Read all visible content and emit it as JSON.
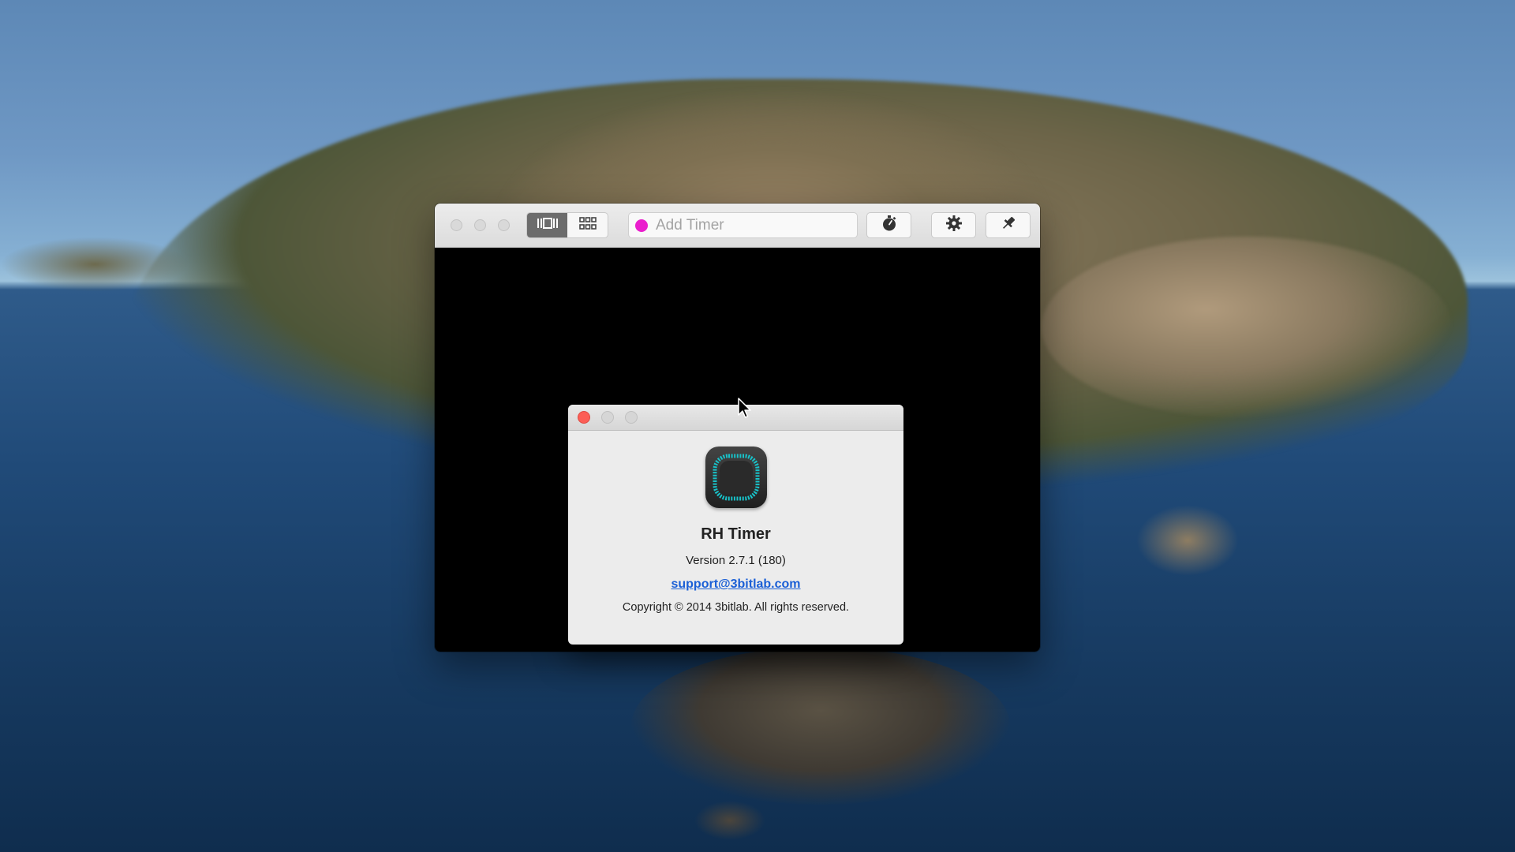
{
  "main_window": {
    "toolbar": {
      "view_modes": [
        "list-view",
        "grid-view"
      ],
      "active_view": "list-view",
      "add_timer_placeholder": "Add Timer",
      "timer_color": "#ea1ecd",
      "buttons": [
        "stopwatch-icon",
        "gear-icon",
        "pin-icon"
      ]
    }
  },
  "about_window": {
    "app_name": "RH Timer",
    "version": "Version 2.7.1 (180)",
    "support_email": "support@3bitlab.com",
    "copyright": "Copyright © 2014 3bitlab. All rights reserved.",
    "icon_ring_color": "#18c2c9"
  }
}
